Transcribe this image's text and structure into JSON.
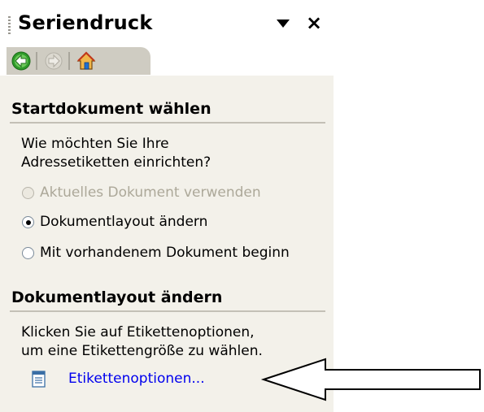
{
  "pane": {
    "title": "Seriendruck",
    "navigation": {
      "back_icon": "back-arrow-icon",
      "forward_icon": "forward-arrow-icon",
      "home_icon": "home-icon"
    }
  },
  "section1": {
    "heading": "Startdokument wählen",
    "prompt_line1": "Wie möchten Sie Ihre",
    "prompt_line2": "Adressetiketten einrichten?",
    "options": [
      {
        "label": "Aktuelles Dokument verwenden",
        "selected": false,
        "disabled": true
      },
      {
        "label": "Dokumentlayout ändern",
        "selected": true,
        "disabled": false
      },
      {
        "label": "Mit vorhandenem Dokument beginn",
        "selected": false,
        "disabled": false
      }
    ]
  },
  "section2": {
    "heading": "Dokumentlayout ändern",
    "info_line1": "Klicken Sie auf Etikettenoptionen,",
    "info_line2": "um eine Etikettengröße zu wählen.",
    "link_label": "Etikettenoptionen...",
    "link_icon": "document-icon"
  },
  "annotation": {
    "arrow_icon": "left-arrow-outline-icon"
  },
  "colors": {
    "panel_bg": "#f3f1ea",
    "link": "#0000ee",
    "disabled_text": "#aca899"
  }
}
